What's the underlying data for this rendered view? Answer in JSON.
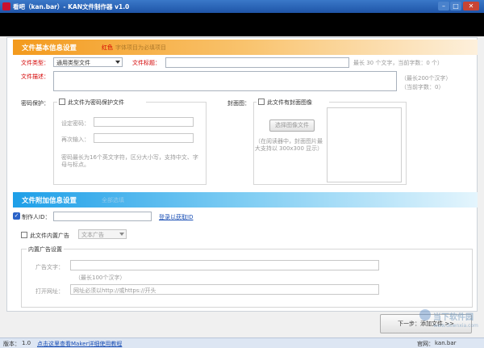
{
  "window": {
    "title": "看吧（kan.bar）- KAN文件制作器 v1.0"
  },
  "section1": {
    "title": "文件基本信息设置",
    "required_hint_red": "红色",
    "required_hint_rest": "字体项目为必填项目"
  },
  "file_type": {
    "label": "文件类型：",
    "value": "通用类型文件"
  },
  "file_title": {
    "label": "文件标题：",
    "value": "",
    "counter": "最长 30 个文字，当前字数：0 个）"
  },
  "file_desc": {
    "label": "文件描述：",
    "value": "",
    "counter_line1": "（最长200个汉字）",
    "counter_line2": "（当前字数：0）"
  },
  "password": {
    "section_label": "密码保护：",
    "checkbox_label": "此文件为密码保护文件",
    "set_label": "设定密码：",
    "repeat_label": "再次输入：",
    "hint": "密码最长为16个英文字符，区分大小写，支持中文、字母与标点。"
  },
  "cover": {
    "section_label": "封面图：",
    "checkbox_label": "此文件有封面图像",
    "select_button": "选择图像文件",
    "hint": "（在阅读器中，封面图片最大支持以 300x300 显示）"
  },
  "section2": {
    "title": "文件附加信息设置",
    "subtitle": "全部选填"
  },
  "author": {
    "label": "制作人ID：",
    "value": "",
    "link": "登录以获取ID"
  },
  "ad": {
    "checkbox_label": "此文件内置广告",
    "type_value": "文本广告",
    "group_title": "内置广告设置",
    "text_label": "广告文字：",
    "text_value": "",
    "text_hint": "（最长100个汉字）",
    "url_label": "打开网址：",
    "url_value": "网址必须以http://或https://开头"
  },
  "next_button": "下一步：添加文件 >>",
  "watermark": {
    "main": "当下软件园",
    "sub": "www.downxia.com"
  },
  "statusbar": {
    "version_label": "版本：",
    "version_value": "1.0",
    "tutorial_link": "点击这里查看Maker详细使用教程",
    "site_label": "官网：",
    "site_value": "kan.bar"
  },
  "colors": {
    "title_blue": "#1f55a8",
    "section1_orange": "#f39a1d",
    "section2_blue": "#1e9fe8",
    "required_red": "#d40000"
  }
}
